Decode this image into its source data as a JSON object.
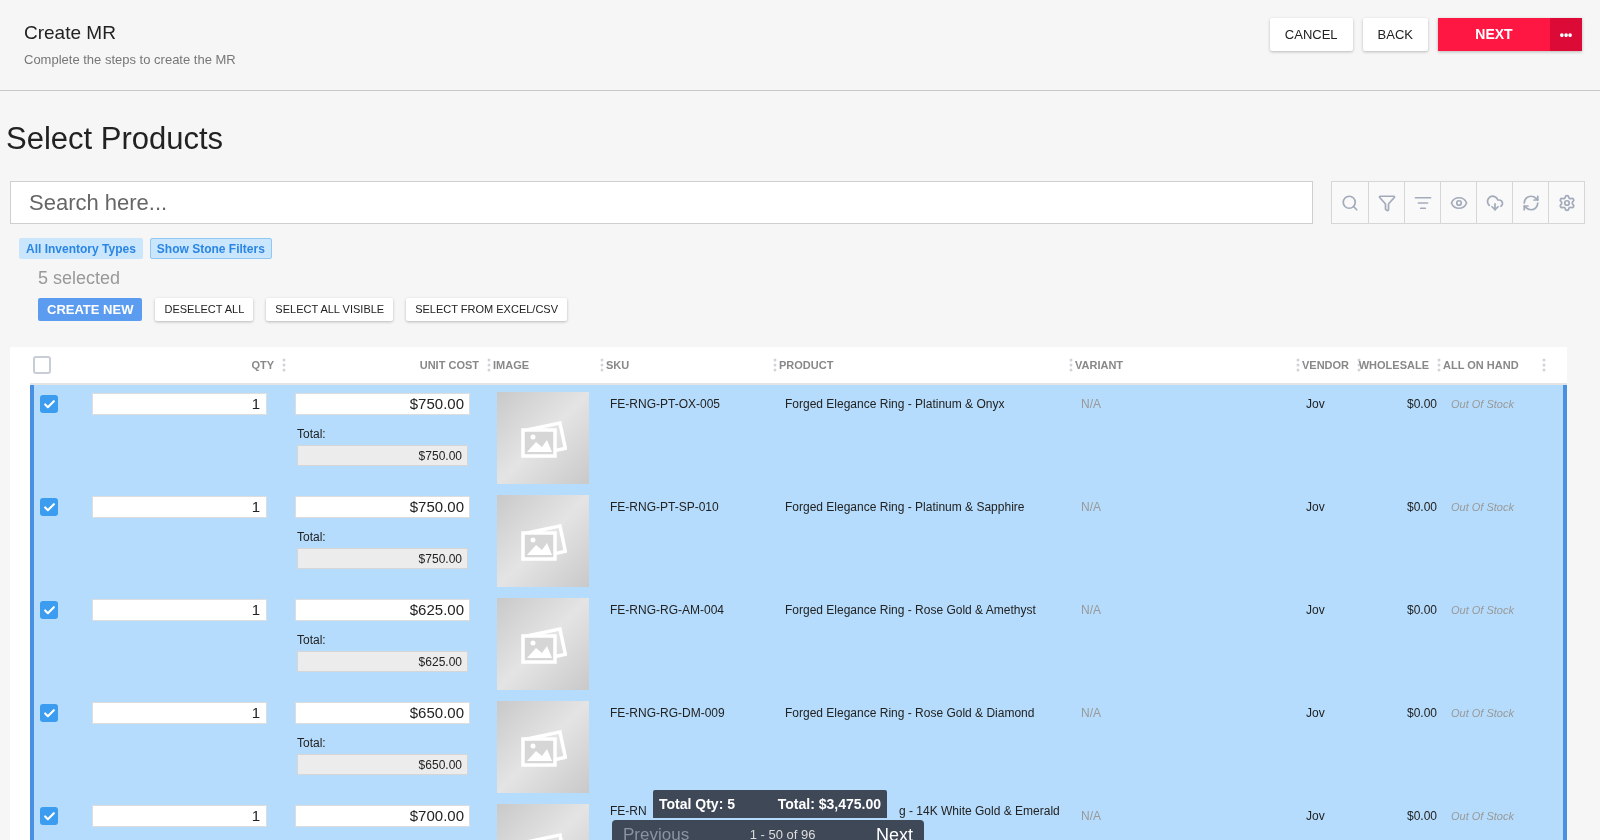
{
  "header": {
    "title": "Create MR",
    "subtitle": "Complete the steps to create the MR",
    "buttons": {
      "cancel": "CANCEL",
      "back": "BACK",
      "next": "NEXT",
      "more": "•••"
    }
  },
  "section_title": "Select Products",
  "search": {
    "placeholder": "Search here..."
  },
  "chips": [
    {
      "label": "All Inventory Types",
      "outlined": false
    },
    {
      "label": "Show Stone Filters",
      "outlined": true
    }
  ],
  "selection_count": "5 selected",
  "actions": [
    {
      "label": "CREATE NEW",
      "kind": "primary"
    },
    {
      "label": "DESELECT ALL",
      "kind": "plain"
    },
    {
      "label": "SELECT ALL VISIBLE",
      "kind": "plain"
    },
    {
      "label": "SELECT FROM EXCEL/CSV",
      "kind": "plain"
    }
  ],
  "table": {
    "header_checked": false,
    "columns": [
      "QTY",
      "UNIT COST",
      "IMAGE",
      "SKU",
      "PRODUCT",
      "VARIANT",
      "VENDOR",
      "WHOLESALE",
      "ALL ON HAND"
    ],
    "rows": [
      {
        "selected": true,
        "kind": "full",
        "qty": "1",
        "unit_cost": "$750.00",
        "total_label": "Total:",
        "total": "$750.00",
        "sku": "FE-RNG-PT-OX-005",
        "product": "Forged Elegance Ring - Platinum & Onyx",
        "variant": "N/A",
        "vendor": "Jov",
        "wholesale": "$0.00",
        "on_hand": "Out Of Stock"
      },
      {
        "selected": true,
        "kind": "full",
        "qty": "1",
        "unit_cost": "$750.00",
        "total_label": "Total:",
        "total": "$750.00",
        "sku": "FE-RNG-PT-SP-010",
        "product": "Forged Elegance Ring - Platinum & Sapphire",
        "variant": "N/A",
        "vendor": "Jov",
        "wholesale": "$0.00",
        "on_hand": "Out Of Stock"
      },
      {
        "selected": true,
        "kind": "full",
        "qty": "1",
        "unit_cost": "$625.00",
        "total_label": "Total:",
        "total": "$625.00",
        "sku": "FE-RNG-RG-AM-004",
        "product": "Forged Elegance Ring - Rose Gold & Amethyst",
        "variant": "N/A",
        "vendor": "Jov",
        "wholesale": "$0.00",
        "on_hand": "Out Of Stock"
      },
      {
        "selected": true,
        "kind": "full",
        "qty": "1",
        "unit_cost": "$650.00",
        "total_label": "Total:",
        "total": "$650.00",
        "sku": "FE-RNG-RG-DM-009",
        "product": "Forged Elegance Ring - Rose Gold & Diamond",
        "variant": "N/A",
        "vendor": "Jov",
        "wholesale": "$0.00",
        "on_hand": "Out Of Stock"
      },
      {
        "selected": true,
        "kind": "covered",
        "qty": "1",
        "unit_cost": "$700.00",
        "sku": "FE-RN",
        "product": "g - 14K White Gold & Emerald",
        "variant": "N/A",
        "vendor": "Jov",
        "wholesale": "$0.00",
        "on_hand": "Out Of Stock"
      }
    ]
  },
  "summary": {
    "total_qty": "Total Qty: 5",
    "total": "Total: $3,475.00"
  },
  "pagination": {
    "previous": "Previous",
    "range": "1 - 50 of 96",
    "next": "Next",
    "previous_disabled": true
  }
}
